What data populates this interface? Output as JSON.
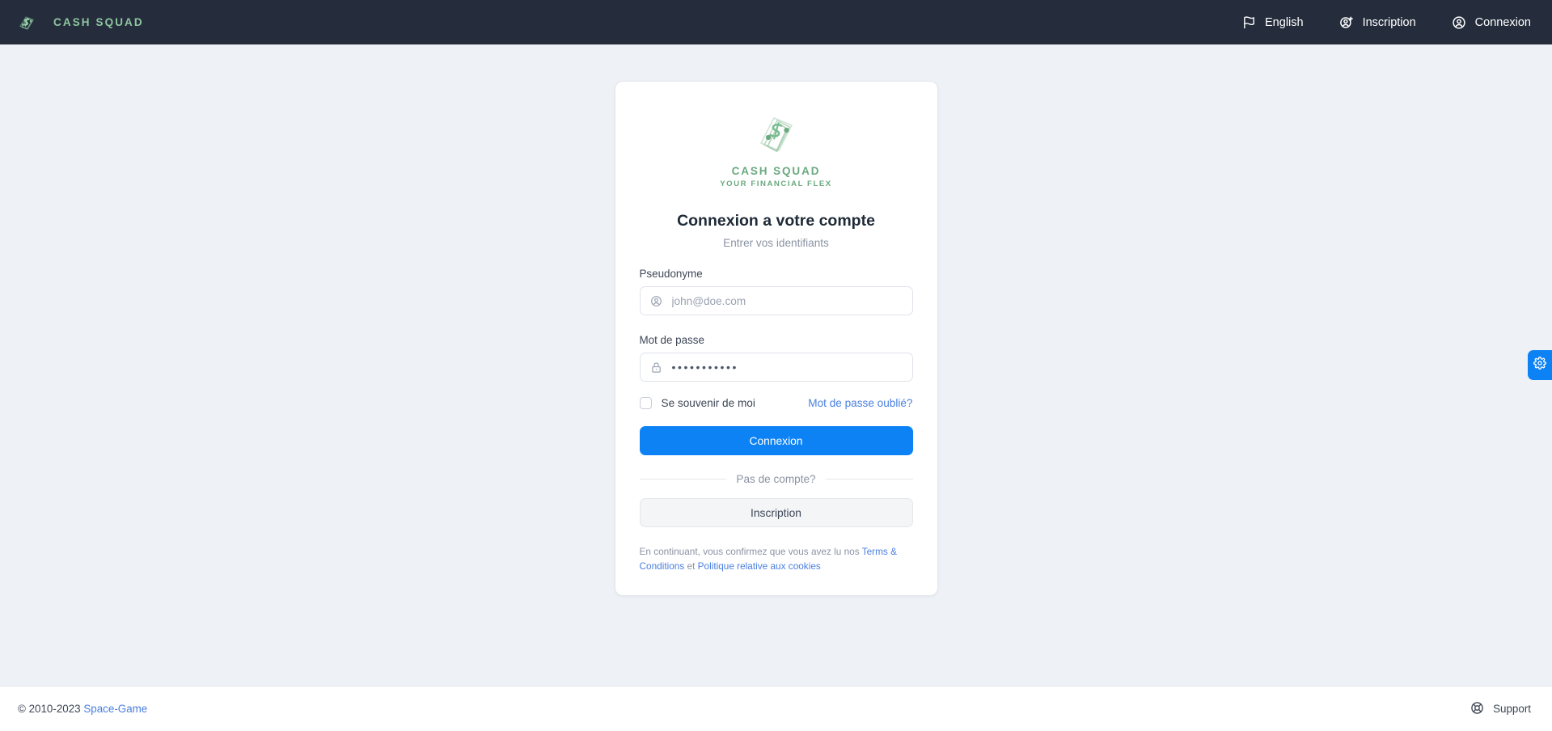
{
  "header": {
    "brand_name": "CASH SQUAD",
    "brand_icon": "cash-squad-logo-icon",
    "nav": [
      {
        "label": "English",
        "icon": "flag-icon"
      },
      {
        "label": "Inscription",
        "icon": "user-plus-icon"
      },
      {
        "label": "Connexion",
        "icon": "user-circle-icon"
      }
    ]
  },
  "card": {
    "logo": {
      "icon": "cash-squad-banknote-s-icon",
      "word": "CASH SQUAD",
      "tagline": "YOUR FINANCIAL FLEX"
    },
    "title": "Connexion a votre compte",
    "subtitle": "Entrer vos identifiants",
    "username": {
      "label": "Pseudonyme",
      "placeholder": "john@doe.com",
      "value": "",
      "icon": "user-circle-icon"
    },
    "password": {
      "label": "Mot de passe",
      "masked_value": "•••••••••••",
      "icon": "lock-icon"
    },
    "remember_label": "Se souvenir de moi",
    "remember_checked": false,
    "forgot_label": "Mot de passe oublié?",
    "submit_label": "Connexion",
    "divider_label": "Pas de compte?",
    "signup_label": "Inscription",
    "terms": {
      "prefix": "En continuant, vous confirmez que vous avez lu nos ",
      "link1": "Terms & Conditions",
      "middle": " et ",
      "link2": "Politique relative aux cookies"
    }
  },
  "footer": {
    "copyright": "© 2010-2023 ",
    "brand_link": "Space-Game",
    "support_label": "Support",
    "support_icon": "life-buoy-icon"
  },
  "settings_tab": {
    "icon": "gear-icon"
  },
  "colors": {
    "header_bg": "#252d3c",
    "page_bg": "#eef1f6",
    "brand_green": "#8fc6a0",
    "logo_green": "#6aa97f",
    "accent_blue": "#0d82f5",
    "link_blue": "#4a7fe0"
  }
}
